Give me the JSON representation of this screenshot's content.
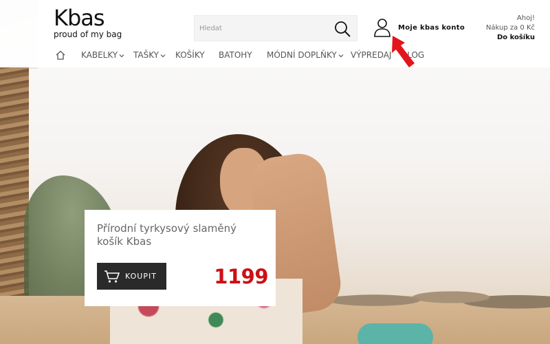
{
  "brand": {
    "name": "Kbas",
    "tagline": "proud of my bag"
  },
  "search": {
    "placeholder": "Hledat",
    "icon": "search-icon"
  },
  "account": {
    "label": "Moje kbas konto",
    "icon": "user-icon"
  },
  "cart": {
    "greeting": "Ahoj!",
    "summary": "Nákup za 0 Kč",
    "link": "Do košíku"
  },
  "nav": {
    "home_icon": "home-icon",
    "items": [
      {
        "label": "KABELKY",
        "has_dropdown": true
      },
      {
        "label": "TAŠKY",
        "has_dropdown": true
      },
      {
        "label": "KOŠÍKY",
        "has_dropdown": false
      },
      {
        "label": "BATOHY",
        "has_dropdown": false
      },
      {
        "label": "MÓDNÍ DOPLŇKY",
        "has_dropdown": true
      },
      {
        "label": "VÝPREDAJ",
        "has_dropdown": false
      },
      {
        "label": "BLOG",
        "has_dropdown": false
      }
    ]
  },
  "promo": {
    "product_title": "Přírodní tyrkysový slaměný košík Kbas",
    "buy_label": "KOUPIT",
    "price": "1199"
  },
  "colors": {
    "accent_price": "#cc1015",
    "arrow": "#e3141b",
    "button_bg": "#2a2a2a"
  }
}
